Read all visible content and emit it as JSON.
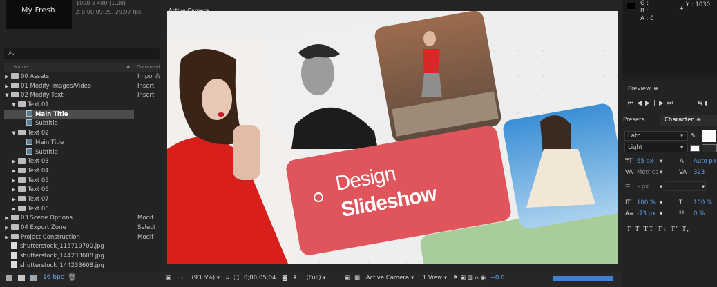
{
  "project": {
    "comp_name": "My Fresh",
    "comp_meta_line1": "1000 x 480 (1.00)",
    "comp_meta_line2": "Δ 0;00;09;29, 29.97 fps",
    "search_glyph": "⌕.",
    "columns": {
      "name": "Name",
      "comment": "Comment"
    },
    "items": [
      {
        "label": "00 Assets",
        "comment": "Impor⁂"
      },
      {
        "label": "01 Modify Images/Video",
        "comment": "Insert"
      },
      {
        "label": "02 Modify Text",
        "comment": "Insert"
      },
      {
        "label": "Text 01",
        "comment": ""
      },
      {
        "label": "Main Title",
        "comment": ""
      },
      {
        "label": "Subtitle",
        "comment": ""
      },
      {
        "label": "Text 02",
        "comment": ""
      },
      {
        "label": "Main Title",
        "comment": ""
      },
      {
        "label": "Subtitle",
        "comment": ""
      },
      {
        "label": "Text 03",
        "comment": ""
      },
      {
        "label": "Text 04",
        "comment": ""
      },
      {
        "label": "Text 05",
        "comment": ""
      },
      {
        "label": "Text 06",
        "comment": ""
      },
      {
        "label": "Text 07",
        "comment": ""
      },
      {
        "label": "Text 08",
        "comment": ""
      },
      {
        "label": "03 Scene Options",
        "comment": "Modif"
      },
      {
        "label": "04 Export Zone",
        "comment": "Select"
      },
      {
        "label": "Project Construction",
        "comment": "Modif"
      },
      {
        "label": "shutterstock_115719700.jpg",
        "comment": ""
      },
      {
        "label": "shutterstock_144233608.jpg",
        "comment": ""
      },
      {
        "label": "shutterstock_144233608.jpg",
        "comment": ""
      }
    ],
    "bpc_label": "16 bpc"
  },
  "composition": {
    "camera_label": "Active Camera",
    "title_line1": "Design",
    "title_line2": "Slideshow",
    "viewer_bar": {
      "zoom": "(93.5%)",
      "timecode": "0;00;05;04",
      "resolution": "(Full)",
      "camera": "Active Camera",
      "views": "1 View",
      "exposure": "+0.0"
    }
  },
  "info": {
    "g": "G :",
    "b": "B :",
    "a": "A : 0",
    "y": "Y : 1030"
  },
  "preview": {
    "title": "Preview"
  },
  "character": {
    "presets_tab": "Presets",
    "tab": "Character",
    "font": "Lato",
    "style": "Light",
    "font_size": "65 px",
    "leading": "Auto px",
    "kerning": "Metrics",
    "tracking": "323",
    "stroke": "- px",
    "vscale": "100 %",
    "hscale": "100 %",
    "baseline": "-73 px",
    "tsume": "0 %",
    "styles": "T  T  TT  Tт  T'  T,"
  },
  "colors": {
    "accent_red": "#e0555b",
    "highlight_blue": "#5fa0ec",
    "green_card": "#a8cc9a"
  }
}
